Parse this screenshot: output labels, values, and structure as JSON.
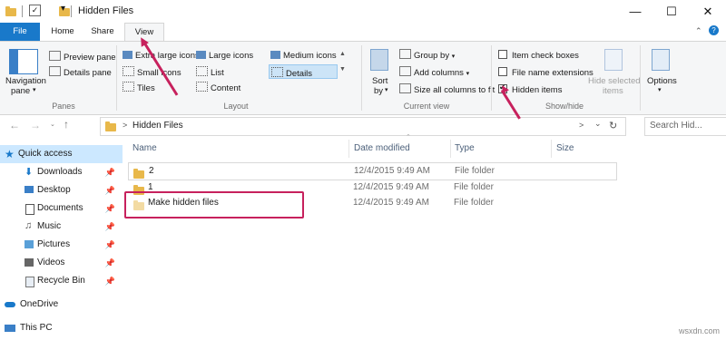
{
  "window": {
    "title": "Hidden Files",
    "controls": [
      "—",
      "☐",
      "✕"
    ]
  },
  "ribbon_tabs": [
    "File",
    "Home",
    "Share",
    "View"
  ],
  "ribbon": {
    "panes": {
      "navigation_pane": "Navigation",
      "navigation_pane_2": "pane",
      "preview_pane": "Preview pane",
      "details_pane": "Details pane",
      "group_label": "Panes"
    },
    "layout": {
      "items": [
        "Extra large icons",
        "Large icons",
        "Medium icons",
        "Small icons",
        "List",
        "Details",
        "Tiles",
        "Content"
      ],
      "group_label": "Layout"
    },
    "current_view": {
      "sort_by": "Sort",
      "sort_by_2": "by",
      "group_by": "Group by",
      "add_columns": "Add columns",
      "size_all_columns": "Size all columns to fit",
      "group_label": "Current view"
    },
    "show_hide": {
      "item_check_boxes": "Item check boxes",
      "file_name_extensions": "File name extensions",
      "hidden_items": "Hidden items",
      "hide_selected": "Hide selected",
      "hide_selected_2": "items",
      "group_label": "Show/hide",
      "checked": {
        "item_check_boxes": false,
        "file_name_extensions": false,
        "hidden_items": true
      }
    },
    "options": "Options"
  },
  "address": {
    "path": "Hidden Files",
    "search_placeholder": "Search Hid..."
  },
  "nav": {
    "quick_access": "Quick access",
    "items": [
      "Downloads",
      "Desktop",
      "Documents",
      "Music",
      "Pictures",
      "Videos",
      "Recycle Bin"
    ],
    "onedrive": "OneDrive",
    "this_pc": "This PC"
  },
  "columns": [
    "Name",
    "Date modified",
    "Type",
    "Size"
  ],
  "files": [
    {
      "name": "2",
      "date": "12/4/2015 9:49 AM",
      "type": "File folder"
    },
    {
      "name": "1",
      "date": "12/4/2015 9:49 AM",
      "type": "File folder"
    },
    {
      "name": "Make hidden files",
      "date": "12/4/2015 9:49 AM",
      "type": "File folder"
    }
  ],
  "watermark": "wsxdn.com",
  "colors": {
    "file_tab": "#1979ca",
    "annotation": "#c7215d",
    "folder": "#e8b84a"
  }
}
